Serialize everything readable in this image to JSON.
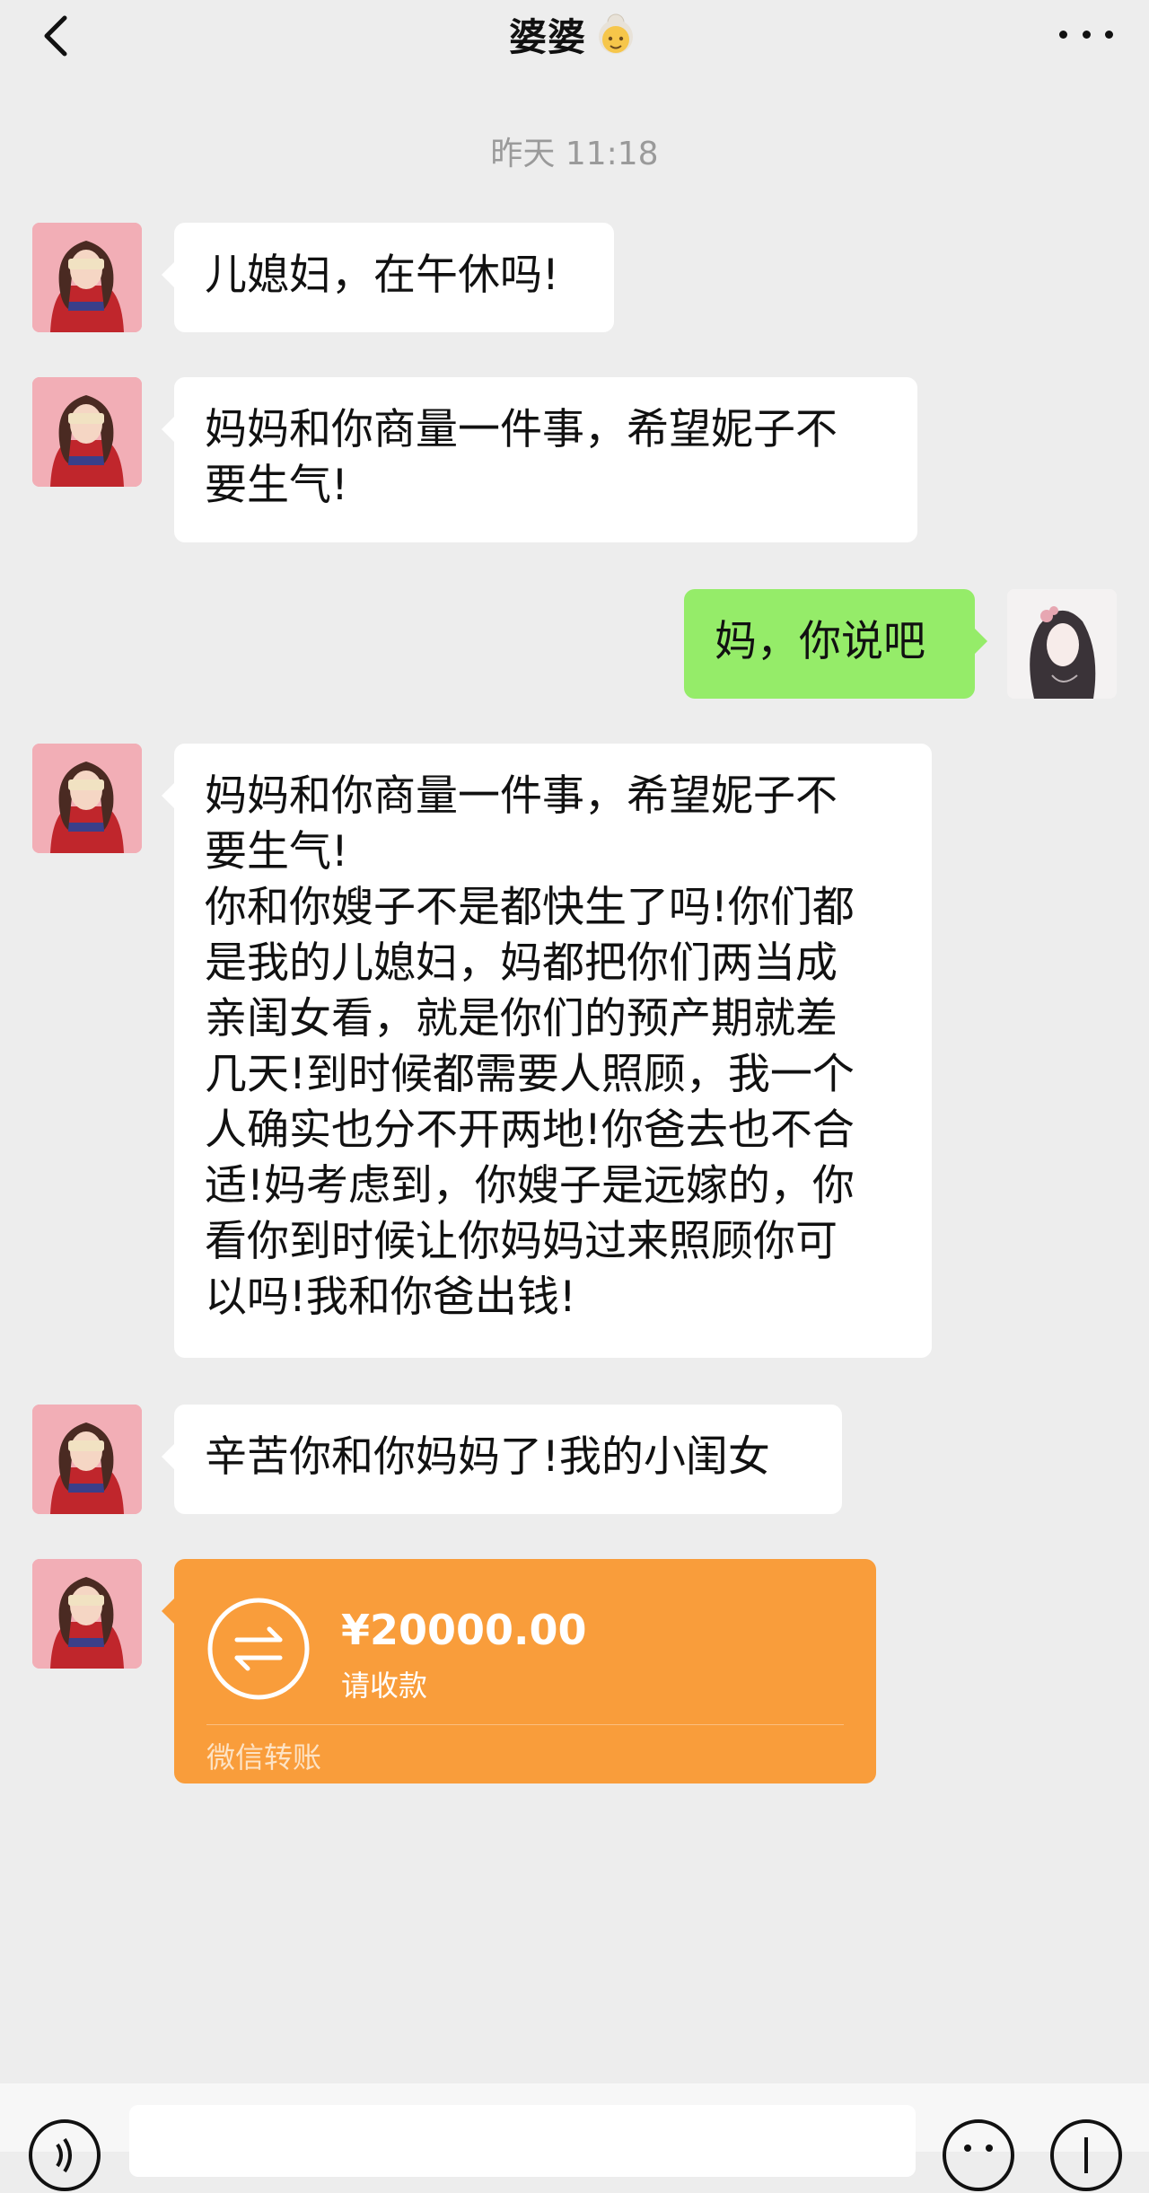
{
  "header": {
    "title": "婆婆",
    "title_emoji": "older-woman-emoji",
    "back_icon": "chevron-left-icon",
    "more_icon": "ellipsis-icon"
  },
  "timestamp": "昨天 11:18",
  "messages": [
    {
      "sender": "mom",
      "text": "儿媳妇，在午休吗!"
    },
    {
      "sender": "mom",
      "text": "妈妈和你商量一件事，希望妮子不\n要生气!"
    },
    {
      "sender": "me",
      "text": "妈，你说吧"
    },
    {
      "sender": "mom",
      "text": "妈妈和你商量一件事，希望妮子不\n要生气!\n你和你嫂子不是都快生了吗!你们都\n是我的儿媳妇，妈都把你们两当成\n亲闺女看，就是你们的预产期就差\n几天!到时候都需要人照顾，我一个\n人确实也分不开两地!你爸去也不合\n适!妈考虑到，你嫂子是远嫁的，你\n看你到时候让你妈妈过来照顾你可\n以吗!我和你爸出钱!"
    },
    {
      "sender": "mom",
      "text": "辛苦你和你妈妈了!我的小闺女"
    }
  ],
  "transfer": {
    "amount": "¥20000.00",
    "status": "请收款",
    "label": "微信转账",
    "icon": "transfer-arrows-icon",
    "color": "#f99d3b"
  },
  "input_bar": {
    "voice_icon": "voice-icon",
    "emoji_icon": "smiley-icon",
    "plus_icon": "plus-circle-icon"
  },
  "colors": {
    "background": "#ededed",
    "my_bubble": "#95ec69",
    "their_bubble": "#ffffff",
    "timestamp": "#9a9a9a"
  }
}
